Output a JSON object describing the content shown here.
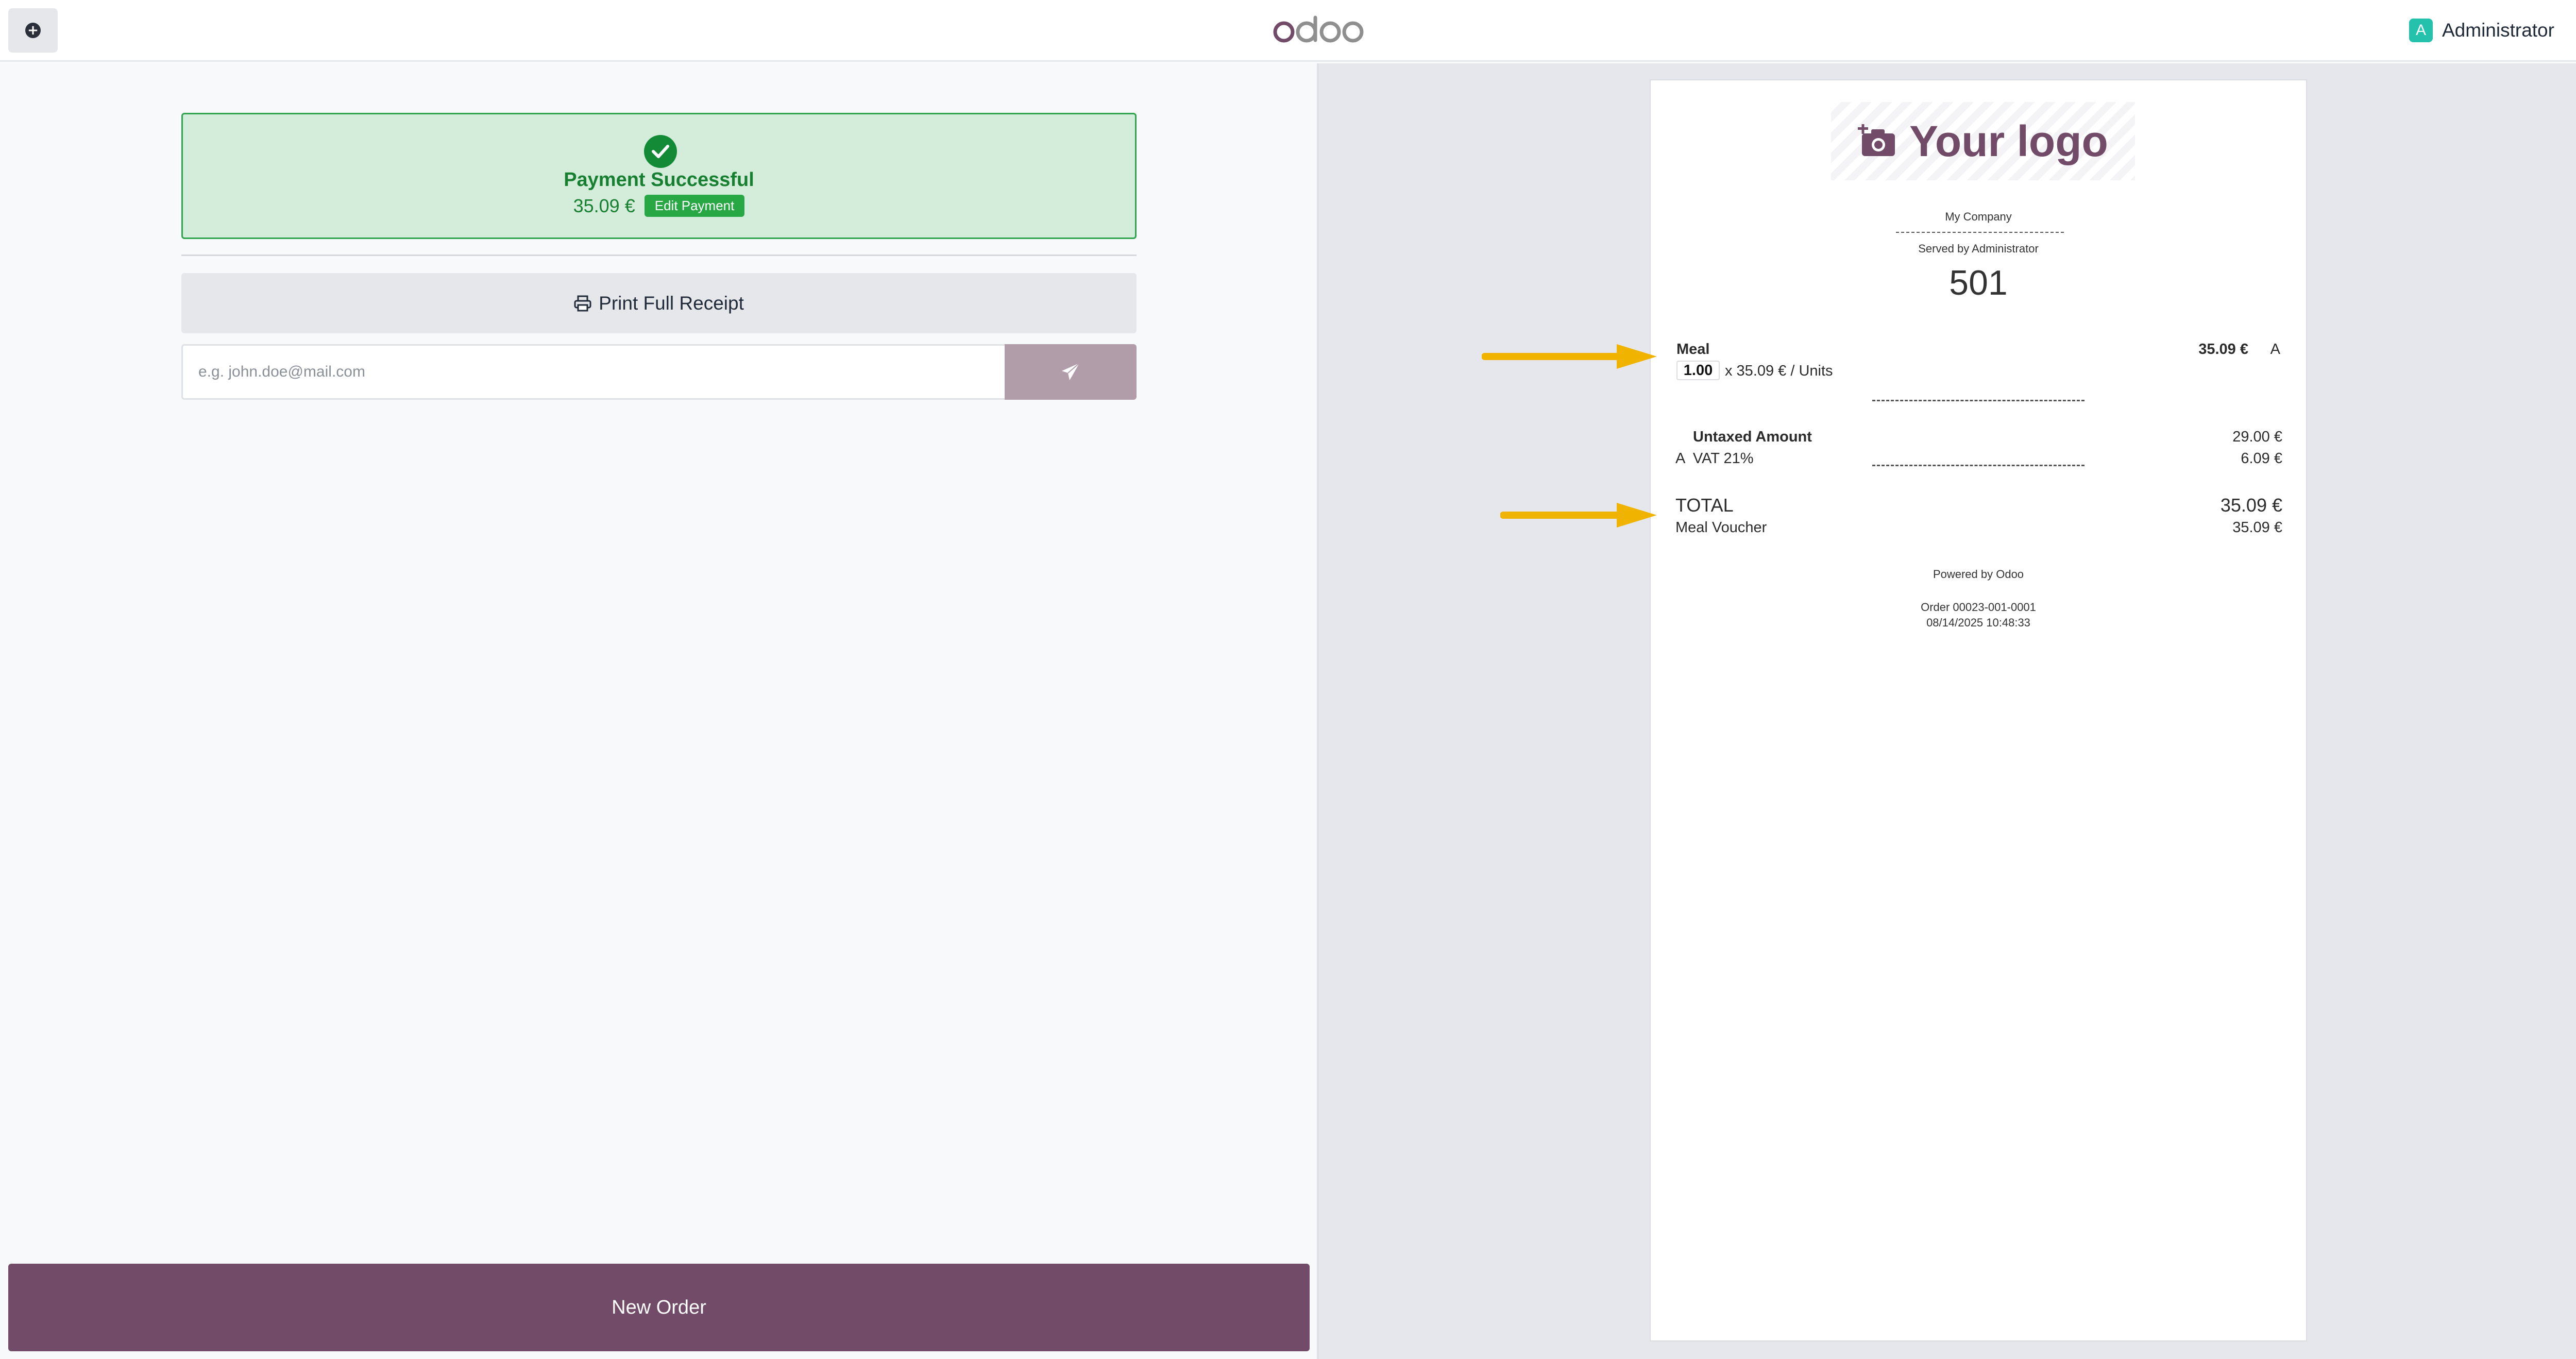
{
  "topbar": {
    "brand": "odoo",
    "user_initial": "A",
    "user_name": "Administrator"
  },
  "payment": {
    "status": "Payment Successful",
    "amount": "35.09 €",
    "edit_label": "Edit Payment"
  },
  "actions": {
    "print_label": "Print Full Receipt",
    "email_placeholder": "e.g. john.doe@mail.com",
    "new_order_label": "New Order"
  },
  "receipt": {
    "logo_text": "Your logo",
    "company": "My Company",
    "served_by": "Served by Administrator",
    "order_number": "501",
    "line": {
      "product": "Meal",
      "price": "35.09 €",
      "tax_code": "A",
      "quantity": "1.00",
      "unit_price": "x 35.09 € / Units"
    },
    "untaxed_label": "Untaxed Amount",
    "untaxed_value": "29.00 €",
    "vat_label": "A  VAT 21%",
    "vat_value": "6.09 €",
    "total_label": "TOTAL",
    "total_value": "35.09 €",
    "payment_method": "Meal Voucher",
    "payment_value": "35.09 €",
    "powered_by": "Powered by Odoo",
    "order_ref": "Order 00023-001-0001",
    "order_datetime": "08/14/2025 10:48:33"
  },
  "colors": {
    "brand_purple": "#714b67",
    "success_green": "#28a745",
    "annotation_arrow": "#f0b400"
  }
}
